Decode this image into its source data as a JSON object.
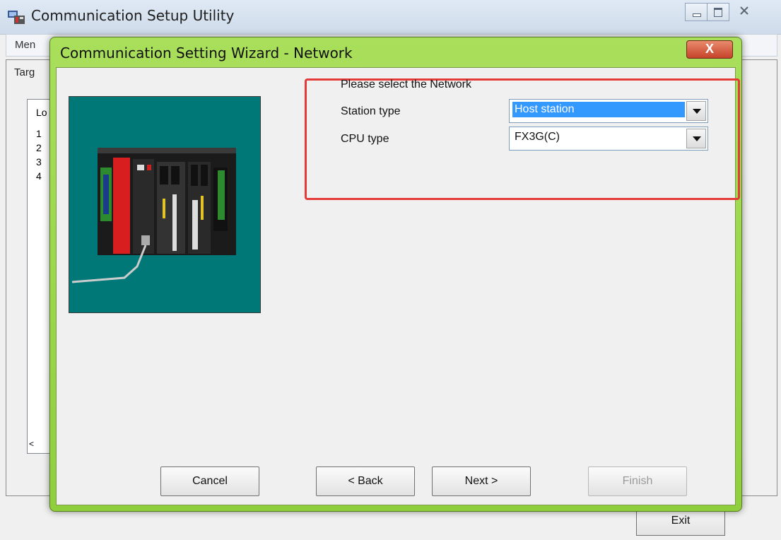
{
  "window": {
    "title": "Communication Setup Utility",
    "menu_label": "Men",
    "tab_label": "Targ",
    "list_header": "Lo",
    "list_rows": [
      "1",
      "2",
      "3",
      "4"
    ],
    "scroll_left": "<",
    "exit_label": "Exit"
  },
  "dialog": {
    "title": "Communication Setting Wizard - Network",
    "close_label": "X",
    "prompt": "Please select the Network",
    "station_type_label": "Station type",
    "station_type_value": "Host station",
    "cpu_type_label": "CPU type",
    "cpu_type_value": "FX3G(C)",
    "buttons": {
      "cancel": "Cancel",
      "back": "< Back",
      "next": "Next >",
      "finish": "Finish"
    }
  },
  "colors": {
    "dialog_frame": "#99d24a",
    "highlight_box": "#e43a3a",
    "image_background": "#007878",
    "selection": "#3399ff"
  }
}
